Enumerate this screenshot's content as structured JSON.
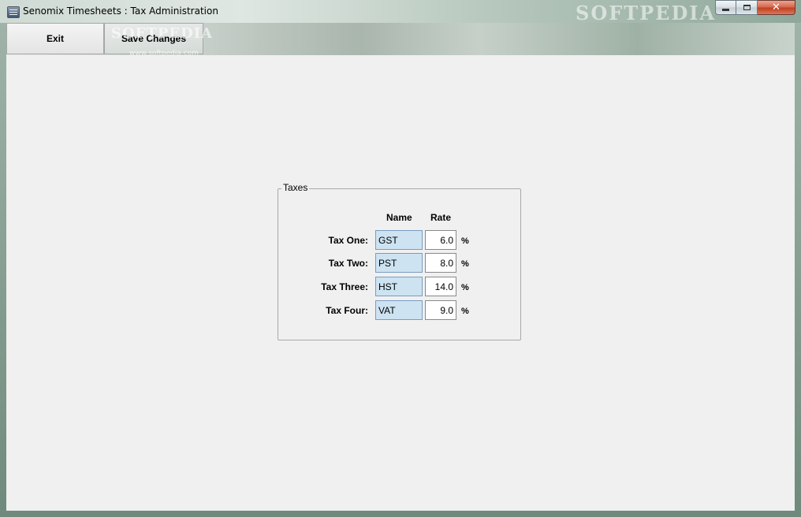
{
  "window": {
    "title": "Senomix Timesheets : Tax Administration",
    "watermark": "SOFTPEDIA",
    "buttons": {
      "minimize": "minimize",
      "maximize": "maximize",
      "close_glyph": "✕"
    }
  },
  "toolbar": {
    "exit_label": "Exit",
    "save_label": "Save Changes",
    "watermark": "SOFTPEDIA",
    "watermark_url": "www.softpedia.com"
  },
  "taxes": {
    "group_title": "Taxes",
    "name_header": "Name",
    "rate_header": "Rate",
    "percent_symbol": "%",
    "rows": [
      {
        "label": "Tax One:",
        "name": "GST",
        "rate": "6.0"
      },
      {
        "label": "Tax Two:",
        "name": "PST",
        "rate": "8.0"
      },
      {
        "label": "Tax Three:",
        "name": "HST",
        "rate": "14.0"
      },
      {
        "label": "Tax Four:",
        "name": "VAT",
        "rate": "9.0"
      }
    ]
  },
  "colors": {
    "name_field_bg": "#cde3f2",
    "panel_bg": "#f0f0f0",
    "close_button": "#c2401f"
  },
  "icons": [
    "app-icon",
    "minimize-icon",
    "maximize-icon",
    "close-icon"
  ]
}
